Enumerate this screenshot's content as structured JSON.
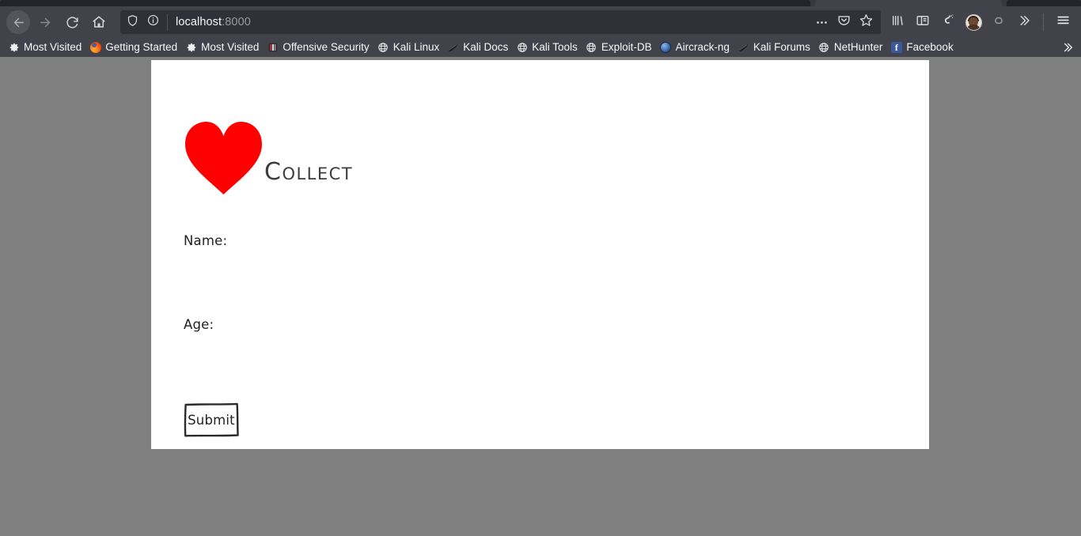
{
  "browser": {
    "nav": {
      "back_label": "Back",
      "forward_label": "Forward",
      "reload_label": "Reload",
      "home_label": "Home"
    },
    "url_bar": {
      "host": "localhost",
      "port": ":8000",
      "shield_icon": "shield-icon",
      "info_icon": "page-info-icon",
      "more_icon": "page-actions-icon",
      "pocket_icon": "pocket-icon",
      "bookmark_icon": "star-icon"
    },
    "toolbar_right": {
      "library_icon": "library-icon",
      "sidebar_icon": "sidebar-icon",
      "extension_icon": "extension-icon",
      "account_icon": "account-avatar-icon",
      "sync_icon": "sync-icon",
      "overflow_icon": "overflow-chevron-icon",
      "menu_icon": "hamburger-menu-icon"
    },
    "bookmarks": {
      "overflow_label": "»",
      "items": [
        {
          "label": "Most Visited",
          "icon": "gear-icon"
        },
        {
          "label": "Getting Started",
          "icon": "firefox-icon"
        },
        {
          "label": "Most Visited",
          "icon": "gear-icon"
        },
        {
          "label": "Offensive Security",
          "icon": "offensive-security-icon"
        },
        {
          "label": "Kali Linux",
          "icon": "globe-icon"
        },
        {
          "label": "Kali Docs",
          "icon": "kali-dragon-icon"
        },
        {
          "label": "Kali Tools",
          "icon": "globe-icon"
        },
        {
          "label": "Exploit-DB",
          "icon": "globe-icon"
        },
        {
          "label": "Aircrack-ng",
          "icon": "disc-icon"
        },
        {
          "label": "Kali Forums",
          "icon": "kali-dragon-icon"
        },
        {
          "label": "NetHunter",
          "icon": "globe-icon"
        },
        {
          "label": "Facebook",
          "icon": "facebook-icon"
        }
      ]
    }
  },
  "page": {
    "brand": {
      "logo_icon": "heart-icon",
      "logo_color": "#ff0000",
      "title": "Collect"
    },
    "form": {
      "name_label": "Name:",
      "name_value": "",
      "name_placeholder": "",
      "age_label": "Age:",
      "age_value": "",
      "age_placeholder": "",
      "submit_label": "Submit"
    },
    "colors": {
      "background": "#808080",
      "card": "#ffffff",
      "ink": "#222222",
      "heading": "#3c3c3c"
    }
  }
}
